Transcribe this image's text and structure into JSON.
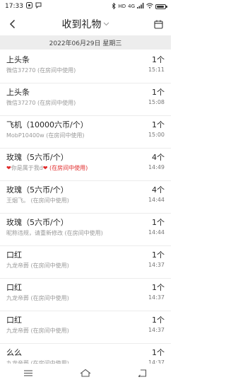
{
  "status_bar": {
    "time": "17:33",
    "network": "4G",
    "hd": "HD"
  },
  "header": {
    "title": "收到礼物"
  },
  "date_bar": {
    "date": "2022年06月29日 星期三"
  },
  "gifts": [
    {
      "name": "上头条",
      "sender": "微信37270 (在房间中使用)",
      "count": "1个",
      "time": "15:11"
    },
    {
      "name": "上头条",
      "sender": "微信37270 (在房间中使用)",
      "count": "1个",
      "time": "15:08"
    },
    {
      "name": "飞机（10000六币/个）",
      "sender": "MobP10400w (在房间中使用)",
      "count": "1个",
      "time": "15:00"
    },
    {
      "name": "玫瑰（5六币/个）",
      "sender_prefix": "❤",
      "sender": "你是属于我d",
      "sender_suffix": "❤ (在房间中使用)",
      "count": "4个",
      "time": "14:49"
    },
    {
      "name": "玫瑰（5六币/个）",
      "sender": "王烟飞。 (在房间中使用)",
      "count": "4个",
      "time": "14:44"
    },
    {
      "name": "玫瑰（5六币/个）",
      "sender": "昵称违规，请重新修改 (在房间中使用)",
      "count": "1个",
      "time": "14:44"
    },
    {
      "name": "口红",
      "sender": "九龙帝葬 (在房间中使用)",
      "count": "1个",
      "time": "14:37"
    },
    {
      "name": "口红",
      "sender": "九龙帝葬 (在房间中使用)",
      "count": "1个",
      "time": "14:37"
    },
    {
      "name": "口红",
      "sender": "九龙帝葬 (在房间中使用)",
      "count": "1个",
      "time": "14:37"
    },
    {
      "name": "么么",
      "sender": "九龙帝葬 (在房间中使用)",
      "count": "1个",
      "time": "14:37"
    }
  ],
  "colors": {
    "accent_heart": "#e02828",
    "date_bar_bg": "#ededed"
  }
}
